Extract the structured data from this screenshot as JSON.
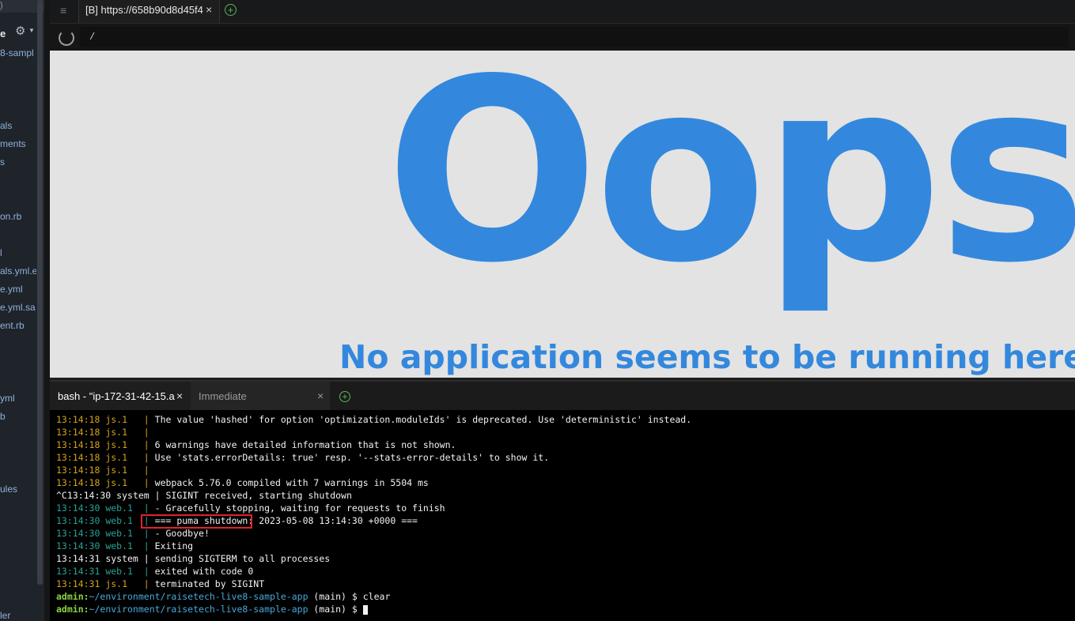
{
  "sidebar": {
    "top_text": ")",
    "project_title": "e",
    "items": [
      "8-sampl",
      "als",
      "ments",
      "s",
      "on.rb",
      "l",
      "als.yml.e",
      "e.yml",
      "e.yml.sa",
      "ent.rb",
      "yml",
      "b",
      "ules",
      "ler"
    ]
  },
  "browser": {
    "tab_label": "[B] https://658b90d8d45f4",
    "url": "/",
    "page": {
      "heading": "Oops",
      "message": "No application seems to be running here!"
    },
    "colors": {
      "accent": "#3388dd",
      "page_bg": "#e3e3e3"
    }
  },
  "terminal": {
    "tabs": [
      {
        "label": "bash - \"ip-172-31-42-15.a"
      },
      {
        "label": "Immediate"
      }
    ],
    "lines": [
      {
        "ts": "13:14:18",
        "proc": "js.1",
        "sep": "|",
        "msg": "The value 'hashed' for option 'optimization.moduleIds' is deprecated. Use 'deterministic' instead."
      },
      {
        "ts": "13:14:18",
        "proc": "js.1",
        "sep": "|",
        "msg": ""
      },
      {
        "ts": "13:14:18",
        "proc": "js.1",
        "sep": "|",
        "msg": "6 warnings have detailed information that is not shown."
      },
      {
        "ts": "13:14:18",
        "proc": "js.1",
        "sep": "|",
        "msg": "Use 'stats.errorDetails: true' resp. '--stats-error-details' to show it."
      },
      {
        "ts": "13:14:18",
        "proc": "js.1",
        "sep": "|",
        "msg": ""
      },
      {
        "ts": "13:14:18",
        "proc": "js.1",
        "sep": "|",
        "msg": "webpack 5.76.0 compiled with 7 warnings in 5504 ms"
      },
      {
        "ts": "^C13:14:30",
        "proc": "system",
        "sep": "|",
        "msg": "SIGINT received, starting shutdown"
      },
      {
        "ts": "13:14:30",
        "proc": "web.1",
        "sep": "|",
        "msg": "- Gracefully stopping, waiting for requests to finish"
      },
      {
        "ts": "13:14:30",
        "proc": "web.1",
        "sep": "|",
        "msg": "=== puma shutdown: 2023-05-08 13:14:30 +0000 ==="
      },
      {
        "ts": "13:14:30",
        "proc": "web.1",
        "sep": "|",
        "msg": "- Goodbye!"
      },
      {
        "ts": "13:14:30",
        "proc": "web.1",
        "sep": "|",
        "msg": "Exiting"
      },
      {
        "ts": "13:14:31",
        "proc": "system",
        "sep": "|",
        "msg": "sending SIGTERM to all processes"
      },
      {
        "ts": "13:14:31",
        "proc": "web.1",
        "sep": "|",
        "msg": "exited with code 0"
      },
      {
        "ts": "13:14:31",
        "proc": "js.1",
        "sep": "|",
        "msg": "terminated by SIGINT"
      }
    ],
    "prompts": [
      {
        "user": "admin:",
        "path": "~/environment/raisetech-live8-sample-app",
        "branch": " (main) $ ",
        "cmd": "clear"
      },
      {
        "user": "admin:",
        "path": "~/environment/raisetech-live8-sample-app",
        "branch": " (main) $ ",
        "cmd": ""
      }
    ],
    "colors": {
      "js": "#d4a21a",
      "web": "#2aa198",
      "system": "#f2f2f2",
      "prompt_user": "#8ad243",
      "prompt_path": "#4aa8d8",
      "highlight": "#e0232a"
    }
  },
  "icons": {
    "sidebar_settings": "gear-icon",
    "tab_menu": "hamburger-icon",
    "reload": "reload-icon",
    "add_tab": "plus-circle-icon",
    "close": "close-icon"
  }
}
